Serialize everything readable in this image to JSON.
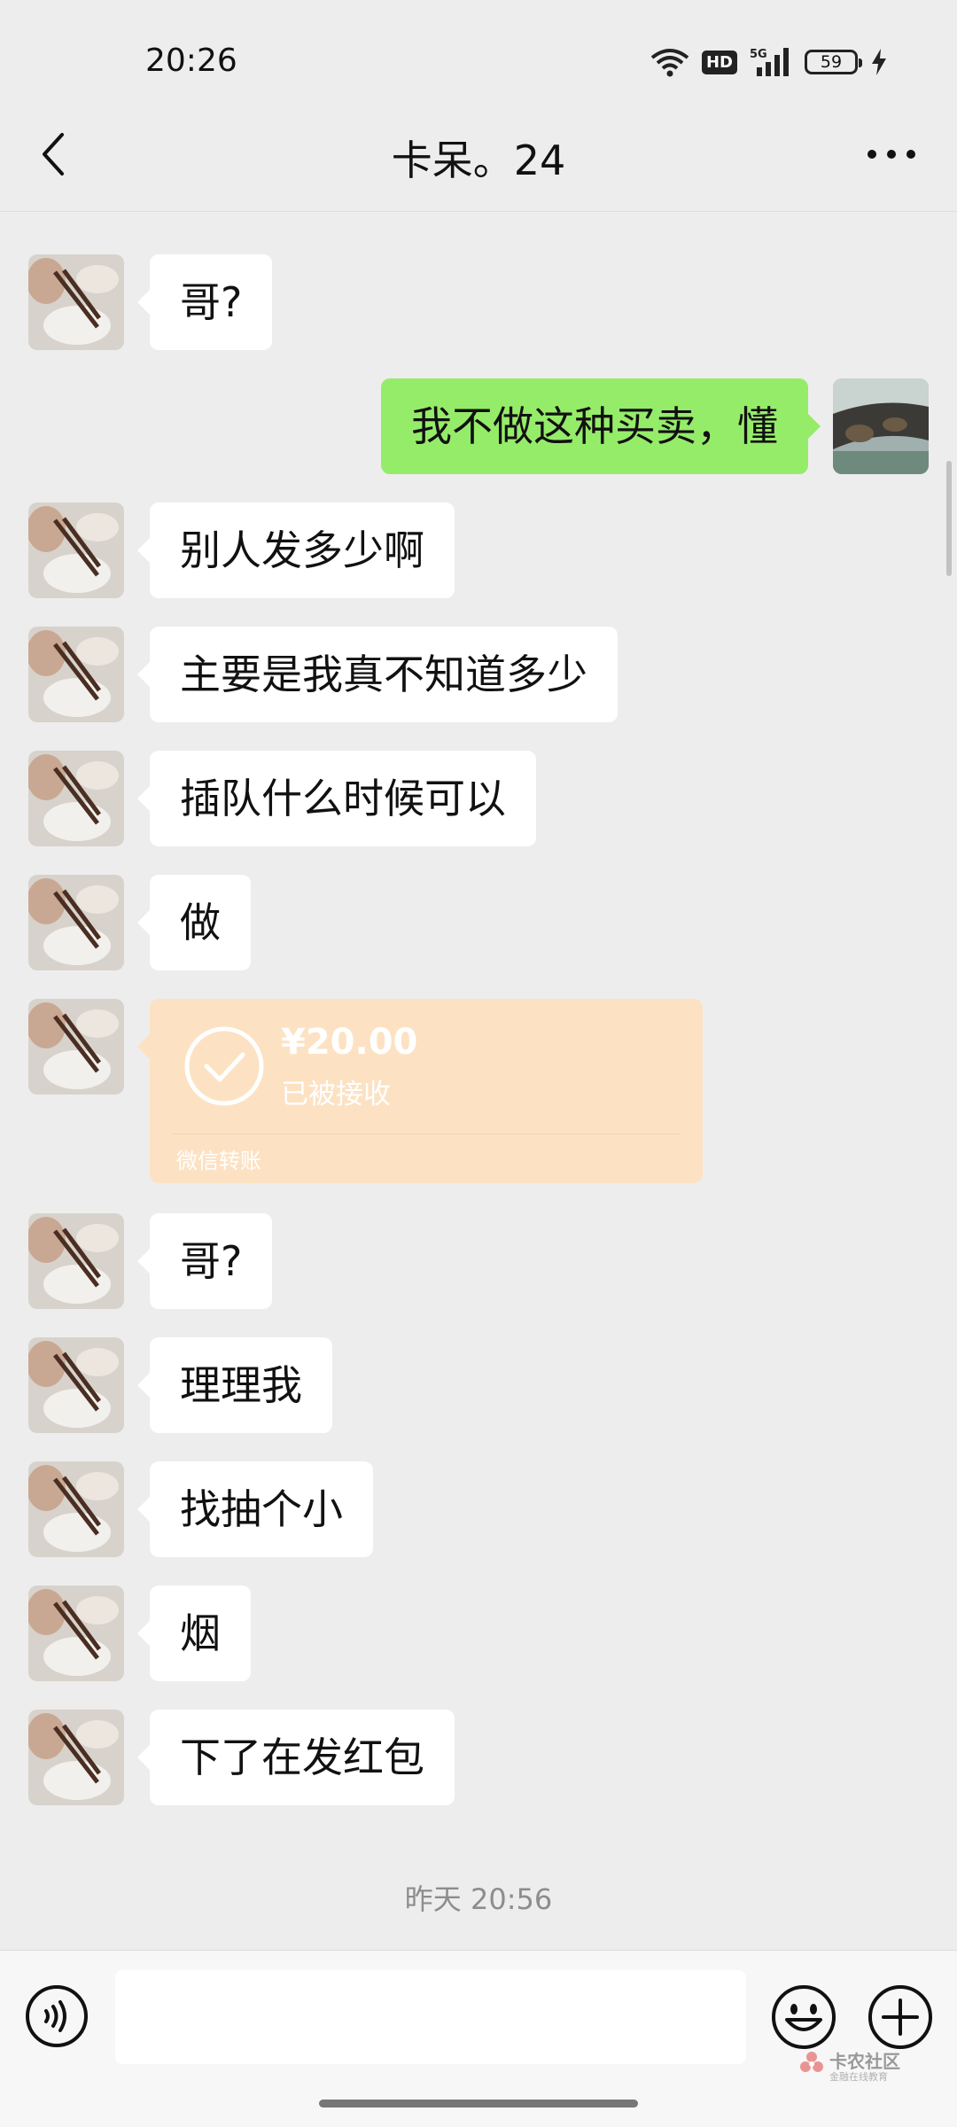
{
  "status_bar": {
    "time": "20:26",
    "hd": "HD",
    "network": "5G",
    "battery": "59"
  },
  "header": {
    "title": "卡呆。24"
  },
  "messages": [
    {
      "side": "left",
      "text": "哥?"
    },
    {
      "side": "right",
      "text": "我不做这种买卖，懂"
    },
    {
      "side": "left",
      "text": "别人发多少啊"
    },
    {
      "side": "left",
      "text": "主要是我真不知道多少"
    },
    {
      "side": "left",
      "text": "插队什么时候可以"
    },
    {
      "side": "left",
      "text": "做"
    },
    {
      "side": "left",
      "type": "transfer",
      "amount": "¥20.00",
      "status": "已被接收",
      "label": "微信转账"
    },
    {
      "side": "left",
      "text": "哥?"
    },
    {
      "side": "left",
      "text": "理理我"
    },
    {
      "side": "left",
      "text": "找抽个小"
    },
    {
      "side": "left",
      "text": "烟"
    },
    {
      "side": "left",
      "text": "下了在发红包"
    }
  ],
  "timestamp": "昨天 20:56",
  "input_bar": {
    "placeholder": "",
    "icons": [
      "voice-icon",
      "emoji-icon",
      "plus-icon"
    ]
  },
  "watermark": {
    "text": "卡农社区",
    "subtext": "金融在线教育"
  },
  "colors": {
    "background": "#ededed",
    "sent_bubble": "#95ec69",
    "received_bubble": "#ffffff",
    "transfer_card": "#fce2c3"
  }
}
